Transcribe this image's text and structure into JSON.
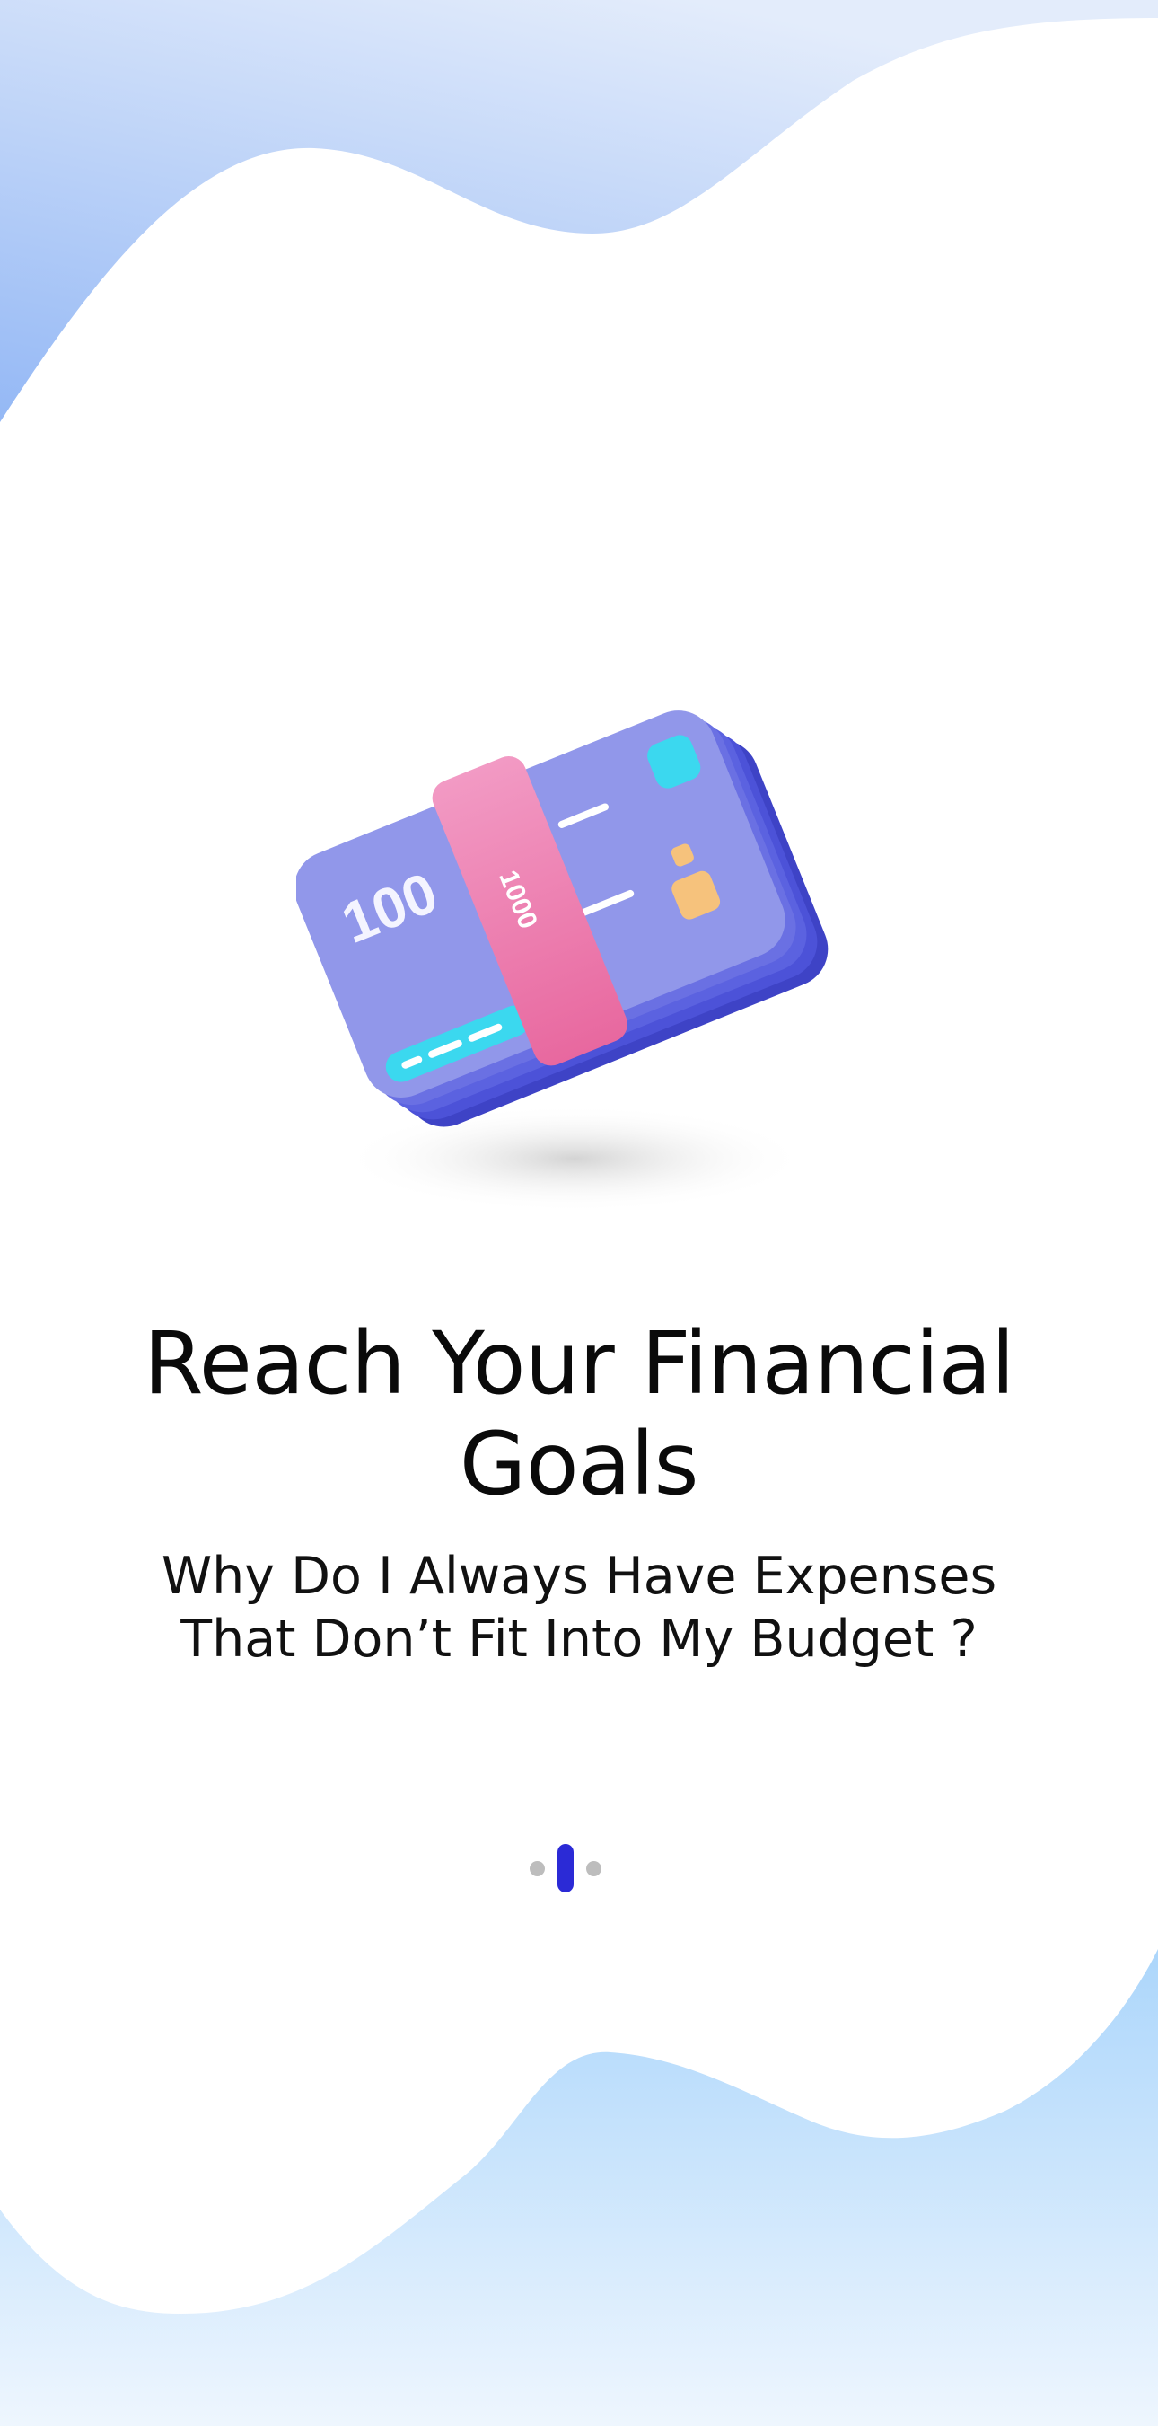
{
  "onboarding": {
    "title": "Reach Your Financial Goals",
    "subtitle_line1": "Why Do I Always Have Expenses",
    "subtitle_line2": "That Don’t Fit Into My Budget ?",
    "illustration": {
      "icon": "money-stack-icon",
      "note_label": "100",
      "band_label": "1000"
    },
    "pager": {
      "total_pages": 3,
      "active_page": 2
    }
  },
  "colors": {
    "accent": "#2b2ad6",
    "inactive_dot": "#bdbdbd",
    "wave_top": "#a9c5f7",
    "wave_bottom": "#b3dcfb",
    "note_purple": "#8e93ea",
    "band_pink": "#ee8fbc"
  }
}
